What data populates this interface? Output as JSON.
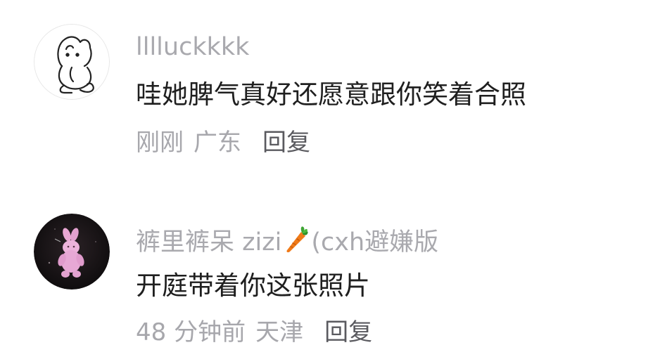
{
  "comments": [
    {
      "username": "lllluckkkk",
      "text": "哇她脾气真好还愿意跟你笑着合照",
      "time": "刚刚",
      "location": "广东",
      "reply_label": "回复",
      "avatar_icon": "bunny-doodle-avatar"
    },
    {
      "username_prefix": "裤里裤呆 zizi",
      "username_suffix": "(cxh避嫌版",
      "username_emoji": "carrot-emoji",
      "text": "开庭带着你这张照片",
      "time": "48 分钟前",
      "location": "天津",
      "reply_label": "回复",
      "avatar_icon": "pink-bunny-plush-avatar"
    }
  ]
}
